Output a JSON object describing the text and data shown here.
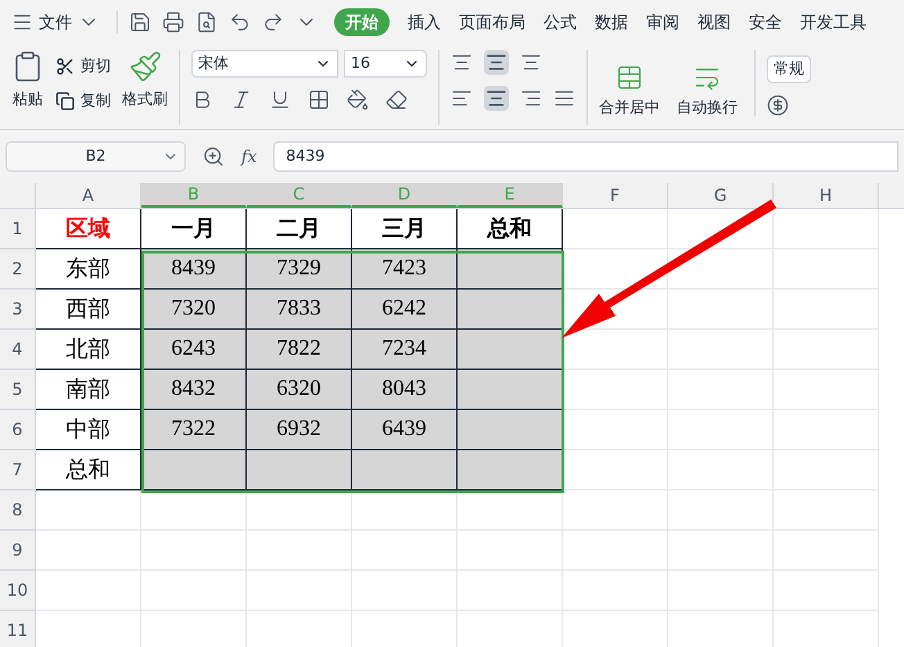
{
  "menu": {
    "file": "文件",
    "tabs": [
      {
        "label": "开始",
        "selected": true
      },
      {
        "label": "插入",
        "selected": false
      },
      {
        "label": "页面布局",
        "selected": false
      },
      {
        "label": "公式",
        "selected": false
      },
      {
        "label": "数据",
        "selected": false
      },
      {
        "label": "审阅",
        "selected": false
      },
      {
        "label": "视图",
        "selected": false
      },
      {
        "label": "安全",
        "selected": false
      },
      {
        "label": "开发工具",
        "selected": false
      }
    ]
  },
  "ribbon": {
    "cut": "剪切",
    "paste": "粘贴",
    "copy": "复制",
    "format_painter": "格式刷",
    "font_name": "宋体",
    "font_size": "16",
    "merge": "合并居中",
    "wrap": "自动换行",
    "number_format": "常规"
  },
  "formula_bar": {
    "cell": "B2",
    "fx": "fx",
    "value": "8439"
  },
  "columns": [
    {
      "label": "A",
      "selected": false
    },
    {
      "label": "B",
      "selected": true
    },
    {
      "label": "C",
      "selected": true
    },
    {
      "label": "D",
      "selected": true
    },
    {
      "label": "E",
      "selected": true
    },
    {
      "label": "F",
      "selected": false
    },
    {
      "label": "G",
      "selected": false
    },
    {
      "label": "H",
      "selected": false
    }
  ],
  "rows": [
    {
      "label": "1",
      "cells": [
        {
          "text": "区域",
          "kind": "header",
          "color": "#ff0000",
          "selected": false
        },
        {
          "text": "一月",
          "kind": "header",
          "color": "#000000",
          "selected": false
        },
        {
          "text": "二月",
          "kind": "header",
          "color": "#000000",
          "selected": false
        },
        {
          "text": "三月",
          "kind": "header",
          "color": "#000000",
          "selected": false
        },
        {
          "text": "总和",
          "kind": "header",
          "color": "#000000",
          "selected": false
        }
      ]
    },
    {
      "label": "2",
      "cells": [
        {
          "text": "东部",
          "kind": "label",
          "selected": false
        },
        {
          "text": "8439",
          "kind": "number",
          "selected": true
        },
        {
          "text": "7329",
          "kind": "number",
          "selected": true
        },
        {
          "text": "7423",
          "kind": "number",
          "selected": true
        },
        {
          "kind": "number",
          "selected": true
        }
      ]
    },
    {
      "label": "3",
      "cells": [
        {
          "text": "西部",
          "kind": "label",
          "selected": false
        },
        {
          "text": "7320",
          "kind": "number",
          "selected": true
        },
        {
          "text": "7833",
          "kind": "number",
          "selected": true
        },
        {
          "text": "6242",
          "kind": "number",
          "selected": true
        },
        {
          "kind": "number",
          "selected": true
        }
      ]
    },
    {
      "label": "4",
      "cells": [
        {
          "text": "北部",
          "kind": "label",
          "selected": false
        },
        {
          "text": "6243",
          "kind": "number",
          "selected": true
        },
        {
          "text": "7822",
          "kind": "number",
          "selected": true
        },
        {
          "text": "7234",
          "kind": "number",
          "selected": true
        },
        {
          "kind": "number",
          "selected": true
        }
      ]
    },
    {
      "label": "5",
      "cells": [
        {
          "text": "南部",
          "kind": "label",
          "selected": false
        },
        {
          "text": "8432",
          "kind": "number",
          "selected": true
        },
        {
          "text": "6320",
          "kind": "number",
          "selected": true
        },
        {
          "text": "8043",
          "kind": "number",
          "selected": true
        },
        {
          "kind": "number",
          "selected": true
        }
      ]
    },
    {
      "label": "6",
      "cells": [
        {
          "text": "中部",
          "kind": "label",
          "selected": false
        },
        {
          "text": "7322",
          "kind": "number",
          "selected": true
        },
        {
          "text": "6932",
          "kind": "number",
          "selected": true
        },
        {
          "text": "6439",
          "kind": "number",
          "selected": true
        },
        {
          "kind": "number",
          "selected": true
        }
      ]
    },
    {
      "label": "7",
      "cells": [
        {
          "text": "总和",
          "kind": "label",
          "selected": false
        },
        {
          "kind": "number",
          "selected": true
        },
        {
          "kind": "number",
          "selected": true
        },
        {
          "kind": "number",
          "selected": true
        },
        {
          "kind": "number",
          "selected": true
        }
      ]
    },
    {
      "label": "8",
      "cells": []
    },
    {
      "label": "9",
      "cells": []
    },
    {
      "label": "10",
      "cells": []
    },
    {
      "label": "11",
      "cells": []
    }
  ]
}
